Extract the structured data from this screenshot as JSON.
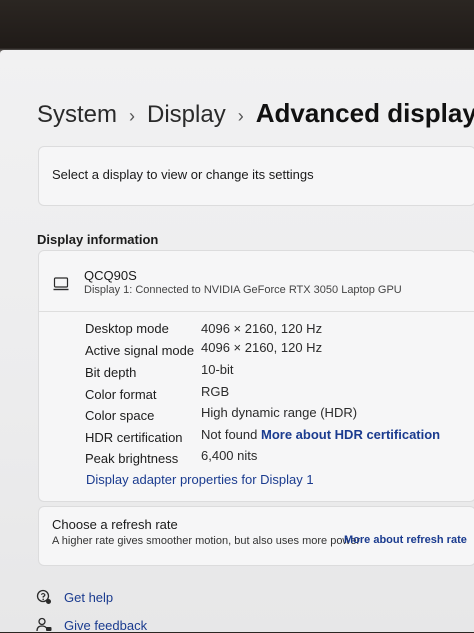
{
  "breadcrumb": {
    "items": [
      "System",
      "Display"
    ],
    "separator": "›",
    "current": "Advanced display"
  },
  "select_display": {
    "label": "Select a display to view or change its settings"
  },
  "display_information": {
    "title": "Display information",
    "monitor": {
      "icon": "monitor-icon",
      "name": "QCQ90S",
      "subtitle": "Display 1: Connected to NVIDIA GeForce RTX 3050 Laptop GPU"
    },
    "properties": [
      {
        "label": "Desktop mode",
        "value": "4096 × 2160, 120 Hz"
      },
      {
        "label": "Active signal mode",
        "value": "4096 × 2160, 120 Hz"
      },
      {
        "label": "Bit depth",
        "value": "10-bit"
      },
      {
        "label": "Color format",
        "value": "RGB"
      },
      {
        "label": "Color space",
        "value": "High dynamic range (HDR)"
      },
      {
        "label": "HDR certification",
        "value": "Not found",
        "link": "More about HDR certification"
      },
      {
        "label": "Peak brightness",
        "value": "6,400 nits"
      }
    ],
    "adapter_link": "Display adapter properties for Display 1"
  },
  "refresh_rate": {
    "title": "Choose a refresh rate",
    "description": "A higher rate gives smoother motion, but also uses more power",
    "link": "More about refresh rate"
  },
  "footer": {
    "get_help": "Get help",
    "give_feedback": "Give feedback"
  },
  "colors": {
    "accent_link": "#1a3b8f",
    "background": "#ececed",
    "card": "#f6f6f7"
  }
}
